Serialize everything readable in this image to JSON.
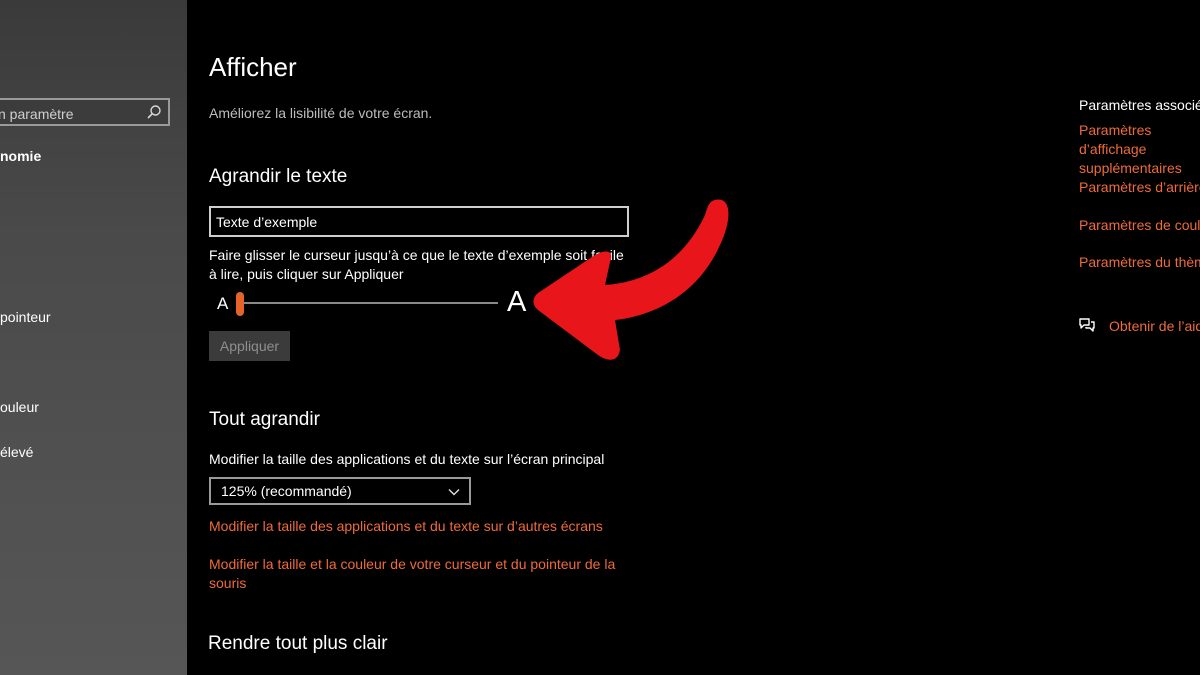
{
  "sidebar": {
    "search": {
      "placeholder": "n paramètre"
    },
    "items": [
      {
        "label": "nomie"
      },
      {
        "label": "pointeur"
      },
      {
        "label": "ouleur"
      },
      {
        "label": "élevé"
      }
    ]
  },
  "main": {
    "title": "Afficher",
    "subtitle": "Améliorez la lisibilité de votre écran.",
    "enlarge_text": {
      "heading": "Agrandir le texte",
      "sample_text": "Texte d’exemple",
      "instructions": "Faire glisser le curseur jusqu’à ce que le texte d’exemple soit facile à lire, puis cliquer sur Appliquer",
      "slider_min_label": "A",
      "slider_max_label": "A",
      "slider_value_fraction": 0.0,
      "apply_label": "Appliquer"
    },
    "enlarge_all": {
      "heading": "Tout agrandir",
      "scale_label": "Modifier la taille des applications et du texte sur l’écran principal",
      "scale_value": "125% (recommandé)",
      "link_other_screens": "Modifier la taille des applications et du texte sur d’autres écrans",
      "link_cursor": "Modifier la taille et la couleur de votre curseur et du pointeur de la souris"
    },
    "clearer": {
      "heading": "Rendre tout plus clair"
    }
  },
  "related": {
    "title": "Paramètres associés",
    "links": [
      "Paramètres d’affichage supplémentaires",
      "Paramètres d’arrière",
      "Paramètres de coule",
      "Paramètres du thème"
    ],
    "help": "Obtenir de l’aide"
  },
  "colors": {
    "accent": "#ee6b3a",
    "annotation_arrow": "#e8161b"
  },
  "icons": {
    "search": "search-icon",
    "dropdown": "chevron-down-icon",
    "help": "chat-bubbles-icon",
    "annotation": "red-curved-arrow-icon"
  }
}
